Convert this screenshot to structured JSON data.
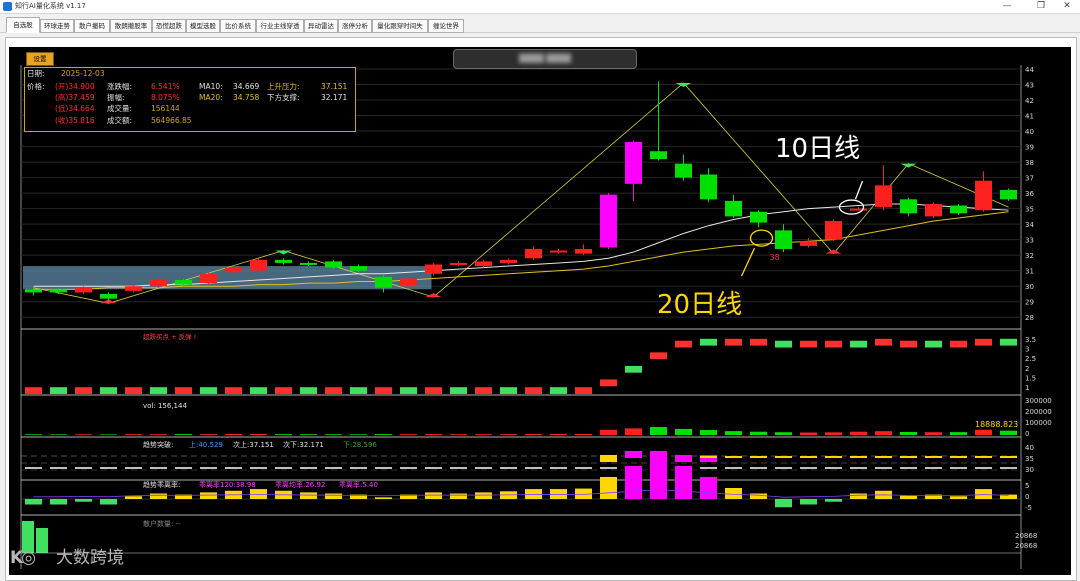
{
  "window": {
    "title": "知行AI量化系统 v1.17",
    "minimize": "—",
    "restore": "❐",
    "close": "✕"
  },
  "tabs": [
    "自选股",
    "环球走势",
    "散户撤码",
    "散朗撤股率",
    "恐慌超跌",
    "模型选股",
    "比价系统",
    "行业主线穿透",
    "异动雷达",
    "涨停分析",
    "量化跟穿时间失",
    "缠论世界"
  ],
  "settings_button": "设置",
  "stock_symbol": "████ ████",
  "info": {
    "date_label": "日期:",
    "date": "2025-12-03",
    "price_label": "价格:",
    "open": "(开)34.900",
    "high": "(高)37.459",
    "low": "(低)34.664",
    "close": "(收)35.816",
    "change_label": "涨跌幅:",
    "change": "6.541%",
    "amplitude_label": "振幅:",
    "amplitude": "8.075%",
    "volume_label": "成交量:",
    "volume": "156144",
    "amount_label": "成交额:",
    "amount": "564966.85",
    "ma10_label": "MA10:",
    "ma10": "34.669",
    "ma20_label": "MA20:",
    "ma20": "34.758",
    "resistance_label": "上升压力:",
    "resistance": "37.151",
    "support_label": "下方支撑:",
    "support": "32.171"
  },
  "annotations": {
    "ma10": "10日线",
    "ma20": "20日线",
    "low_marker": "38"
  },
  "price_axis": {
    "ticks": [
      "44",
      "43",
      "42",
      "41",
      "40",
      "39",
      "38",
      "37",
      "36",
      "35",
      "34",
      "33",
      "32",
      "31",
      "30",
      "29",
      "28"
    ],
    "min": 27.5,
    "max": 44
  },
  "panels": {
    "p2_label": "超跌买点 + 反弹 !",
    "p2_ticks": [
      "3.5",
      "3",
      "2.5",
      "2",
      "1.5",
      "1"
    ],
    "p3_label": "vol: 156,144",
    "p3_ticks": [
      "300000",
      "200000",
      "100000",
      "0"
    ],
    "p3_value": "18888.823",
    "p4_label": "趋势突破:",
    "p4_up": "上:40.529",
    "p4_up2": "次上:37.151",
    "p4_down2": "次下:32.171",
    "p4_down": "下:28.596",
    "p4_ticks": [
      "40",
      "35",
      "30"
    ],
    "p5_label": "趋势乖离率:",
    "p5_a": "乖离率120:38.98",
    "p5_b": "乖离均率:26.92",
    "p5_c": "乖离率:5.40",
    "p5_ticks": [
      "5",
      "0",
      "-5"
    ],
    "p6_label": "散户数量: --",
    "p6_ticks": [
      "20868",
      "20868"
    ]
  },
  "watermark": {
    "logo": "K◎",
    "text": "大数跨境"
  },
  "colors": {
    "up": "#ff2020",
    "down": "#00e000",
    "limit": "#ff00ff",
    "ma10": "#e8e8e8",
    "ma20": "#e0c020",
    "annotation_yellow": "#ffd700",
    "chart_bg": "#000000"
  },
  "chart_data": {
    "type": "candlestick",
    "title": "",
    "ylim": [
      27.5,
      44
    ],
    "candles": [
      {
        "o": 29.8,
        "c": 29.6,
        "h": 29.9,
        "l": 29.4
      },
      {
        "o": 29.8,
        "c": 29.6,
        "h": 29.9,
        "l": 29.5
      },
      {
        "o": 29.6,
        "c": 29.9,
        "h": 30.0,
        "l": 29.5
      },
      {
        "o": 29.5,
        "c": 29.2,
        "h": 29.6,
        "l": 29.0
      },
      {
        "o": 29.7,
        "c": 30.0,
        "h": 30.1,
        "l": 29.6
      },
      {
        "o": 30.0,
        "c": 30.4,
        "h": 30.5,
        "l": 29.9
      },
      {
        "o": 30.4,
        "c": 30.1,
        "h": 30.5,
        "l": 30.0
      },
      {
        "o": 30.2,
        "c": 30.8,
        "h": 30.9,
        "l": 30.1
      },
      {
        "o": 30.9,
        "c": 31.2,
        "h": 31.3,
        "l": 30.8
      },
      {
        "o": 31.0,
        "c": 31.7,
        "h": 31.8,
        "l": 30.9
      },
      {
        "o": 31.7,
        "c": 31.5,
        "h": 31.8,
        "l": 31.4
      },
      {
        "o": 31.5,
        "c": 31.4,
        "h": 31.6,
        "l": 31.3
      },
      {
        "o": 31.6,
        "c": 31.2,
        "h": 31.7,
        "l": 31.1
      },
      {
        "o": 31.3,
        "c": 31.0,
        "h": 31.4,
        "l": 30.9
      },
      {
        "o": 30.6,
        "c": 29.9,
        "h": 30.7,
        "l": 29.6
      },
      {
        "o": 30.0,
        "c": 30.5,
        "h": 30.6,
        "l": 29.9
      },
      {
        "o": 30.8,
        "c": 31.4,
        "h": 31.5,
        "l": 30.7
      },
      {
        "o": 31.4,
        "c": 31.5,
        "h": 31.6,
        "l": 31.3
      },
      {
        "o": 31.3,
        "c": 31.6,
        "h": 31.7,
        "l": 31.2
      },
      {
        "o": 31.5,
        "c": 31.7,
        "h": 31.8,
        "l": 31.4
      },
      {
        "o": 31.8,
        "c": 32.4,
        "h": 32.6,
        "l": 31.7
      },
      {
        "o": 32.2,
        "c": 32.3,
        "h": 32.4,
        "l": 32.1
      },
      {
        "o": 32.1,
        "c": 32.4,
        "h": 32.7,
        "l": 32.0
      },
      {
        "o": 32.5,
        "c": 35.9,
        "h": 36.0,
        "l": 32.4
      },
      {
        "o": 36.6,
        "c": 39.3,
        "h": 39.4,
        "l": 35.5
      },
      {
        "o": 38.7,
        "c": 38.2,
        "h": 43.2,
        "l": 38.1
      },
      {
        "o": 37.9,
        "c": 37.0,
        "h": 38.5,
        "l": 36.8
      },
      {
        "o": 37.2,
        "c": 35.6,
        "h": 37.6,
        "l": 35.4
      },
      {
        "o": 35.5,
        "c": 34.5,
        "h": 35.9,
        "l": 34.4
      },
      {
        "o": 34.8,
        "c": 34.1,
        "h": 34.9,
        "l": 33.8
      },
      {
        "o": 33.6,
        "c": 32.4,
        "h": 34.0,
        "l": 32.2
      },
      {
        "o": 32.6,
        "c": 32.9,
        "h": 33.1,
        "l": 32.5
      },
      {
        "o": 33.0,
        "c": 34.2,
        "h": 34.3,
        "l": 32.9
      },
      {
        "o": 35.0,
        "c": 35.0,
        "h": 35.1,
        "l": 34.9
      },
      {
        "o": 35.1,
        "c": 36.5,
        "h": 37.8,
        "l": 34.9
      },
      {
        "o": 35.6,
        "c": 34.7,
        "h": 35.7,
        "l": 34.5
      },
      {
        "o": 34.5,
        "c": 35.3,
        "h": 35.4,
        "l": 34.4
      },
      {
        "o": 35.2,
        "c": 34.7,
        "h": 35.3,
        "l": 34.6
      },
      {
        "o": 34.9,
        "c": 36.8,
        "h": 37.4,
        "l": 34.8
      },
      {
        "o": 36.2,
        "c": 35.6,
        "h": 36.3,
        "l": 35.5
      }
    ],
    "ma10": [
      30.0,
      30.0,
      30.0,
      30.0,
      30.0,
      30.1,
      30.1,
      30.2,
      30.3,
      30.4,
      30.5,
      30.6,
      30.7,
      30.8,
      30.8,
      30.9,
      31.0,
      31.1,
      31.2,
      31.3,
      31.4,
      31.5,
      31.6,
      31.8,
      32.2,
      32.8,
      33.4,
      33.9,
      34.3,
      34.6,
      34.8,
      35.0,
      35.1,
      35.2,
      35.3,
      35.3,
      35.2,
      35.1,
      35.0,
      34.9
    ],
    "ma20": [
      29.8,
      29.8,
      29.8,
      29.9,
      29.9,
      29.9,
      30.0,
      30.0,
      30.0,
      30.1,
      30.1,
      30.2,
      30.2,
      30.3,
      30.3,
      30.4,
      30.5,
      30.6,
      30.7,
      30.8,
      30.9,
      31.0,
      31.1,
      31.3,
      31.6,
      31.9,
      32.2,
      32.4,
      32.6,
      32.7,
      32.8,
      32.9,
      33.0,
      33.3,
      33.6,
      33.9,
      34.2,
      34.4,
      34.6,
      34.8
    ]
  }
}
